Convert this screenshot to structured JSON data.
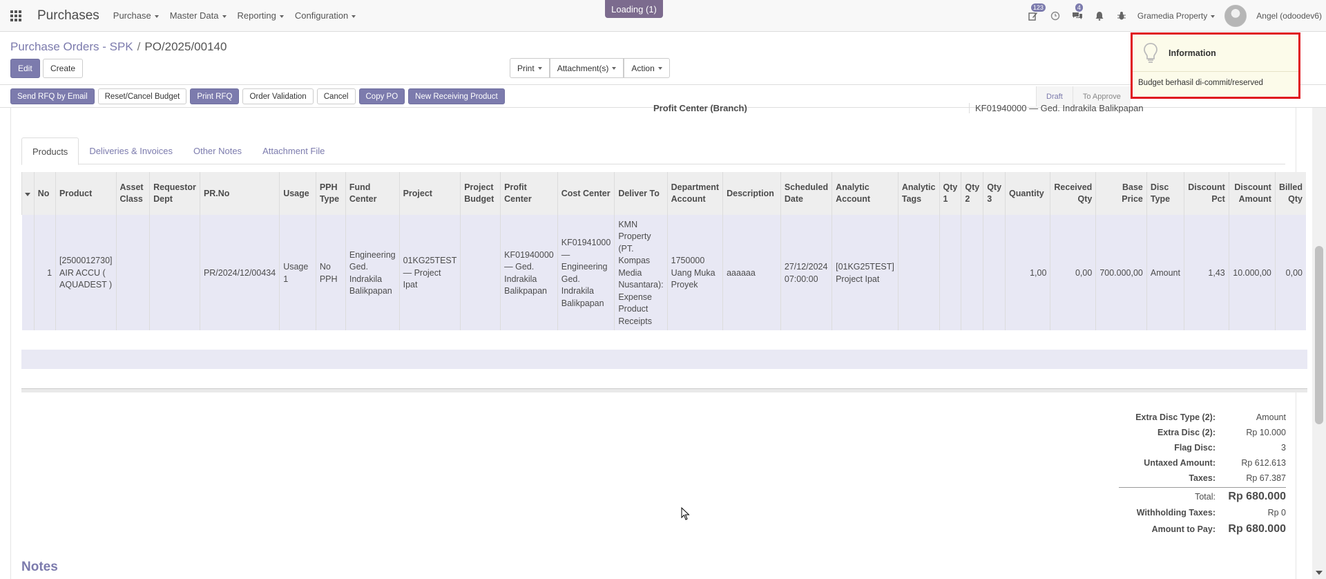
{
  "app": {
    "name": "Purchases"
  },
  "top_menu": [
    "Purchase",
    "Master Data",
    "Reporting",
    "Configuration"
  ],
  "loading_text": "Loading (1)",
  "nav_right": {
    "badge_activity": "123",
    "badge_messages": "4",
    "company": "Gramedia Property",
    "user": "Angel (odoodev6)"
  },
  "breadcrumb": {
    "parent": "Purchase Orders - SPK",
    "current": "PO/2025/00140"
  },
  "control": {
    "edit": "Edit",
    "create": "Create",
    "print": "Print",
    "attachments": "Attachment(s)",
    "action": "Action"
  },
  "header_actions": [
    "Send RFQ by Email",
    "Reset/Cancel Budget",
    "Print RFQ",
    "Order Validation",
    "Cancel",
    "Copy PO",
    "New Receiving Product"
  ],
  "stages": [
    "Draft",
    "To Approve"
  ],
  "profit_center": {
    "label": "Profit Center (Branch)",
    "value": "KF01940000 — Ged. Indrakila Balikpapan"
  },
  "tabs": [
    "Products",
    "Deliveries & Invoices",
    "Other Notes",
    "Attachment File"
  ],
  "table": {
    "headers": {
      "no": "No",
      "product": "Product",
      "asset_class": "Asset Class",
      "requestor": "Requestor Dept",
      "pr_no": "PR.No",
      "usage": "Usage",
      "pph": "PPH Type",
      "fund": "Fund Center",
      "project": "Project",
      "budget": "Project Budget",
      "profit": "Profit Center",
      "cost": "Cost Center",
      "deliver": "Deliver To",
      "dept_acc": "Department Account",
      "desc": "Description",
      "sched": "Scheduled Date",
      "analytic": "Analytic Account",
      "tags": "Analytic Tags",
      "qty1": "Qty 1",
      "qty2": "Qty 2",
      "qty3": "Qty 3",
      "qty": "Quantity",
      "recv": "Received Qty",
      "base": "Base Price",
      "disc_type": "Disc Type",
      "disc_pct": "Discount Pct",
      "disc_amt": "Discount Amount",
      "billed": "Billed Qty"
    },
    "row": {
      "no": "1",
      "product": "[2500012730] AIR ACCU ( AQUADEST )",
      "asset_class": "",
      "requestor": "",
      "pr_no": "PR/2024/12/00434",
      "usage": "Usage 1",
      "pph": "No PPH",
      "fund": "Engineering Ged. Indrakila Balikpapan",
      "project": "01KG25TEST — Project Ipat",
      "budget": "",
      "profit": "KF01940000 — Ged. Indrakila Balikpapan",
      "cost": "KF01941000 — Engineering Ged. Indrakila Balikpapan",
      "deliver": "KMN Property (PT. Kompas Media Nusantara): Expense Product Receipts",
      "dept_acc": "1750000 Uang Muka Proyek",
      "desc": "aaaaaa",
      "sched": "27/12/2024 07:00:00",
      "analytic": "[01KG25TEST] Project Ipat",
      "tags": "",
      "qty1": "",
      "qty2": "",
      "qty3": "",
      "qty": "1,00",
      "recv": "0,00",
      "base": "700.000,00",
      "disc_type": "Amount",
      "disc_pct": "1,43",
      "disc_amt": "10.000,00",
      "billed": "0,00"
    }
  },
  "totals": {
    "extra_disc_type_label": "Extra Disc Type (2):",
    "extra_disc_type": "Amount",
    "extra_disc_label": "Extra Disc (2):",
    "extra_disc": "Rp 10.000",
    "flag_disc_label": "Flag Disc:",
    "flag_disc": "3",
    "untaxed_label": "Untaxed Amount:",
    "untaxed": "Rp 612.613",
    "taxes_label": "Taxes:",
    "taxes": "Rp 67.387",
    "total_label": "Total:",
    "total": "Rp 680.000",
    "withholding_label": "Withholding Taxes:",
    "withholding": "Rp 0",
    "pay_label": "Amount to Pay:",
    "pay": "Rp 680.000"
  },
  "notes_title": "Notes",
  "notification": {
    "title": "Information",
    "body": "Budget berhasil di-commit/reserved"
  },
  "colors": {
    "accent": "#7c7bad",
    "highlight_border": "#e0141e",
    "row_bg": "#e8e8f4"
  }
}
